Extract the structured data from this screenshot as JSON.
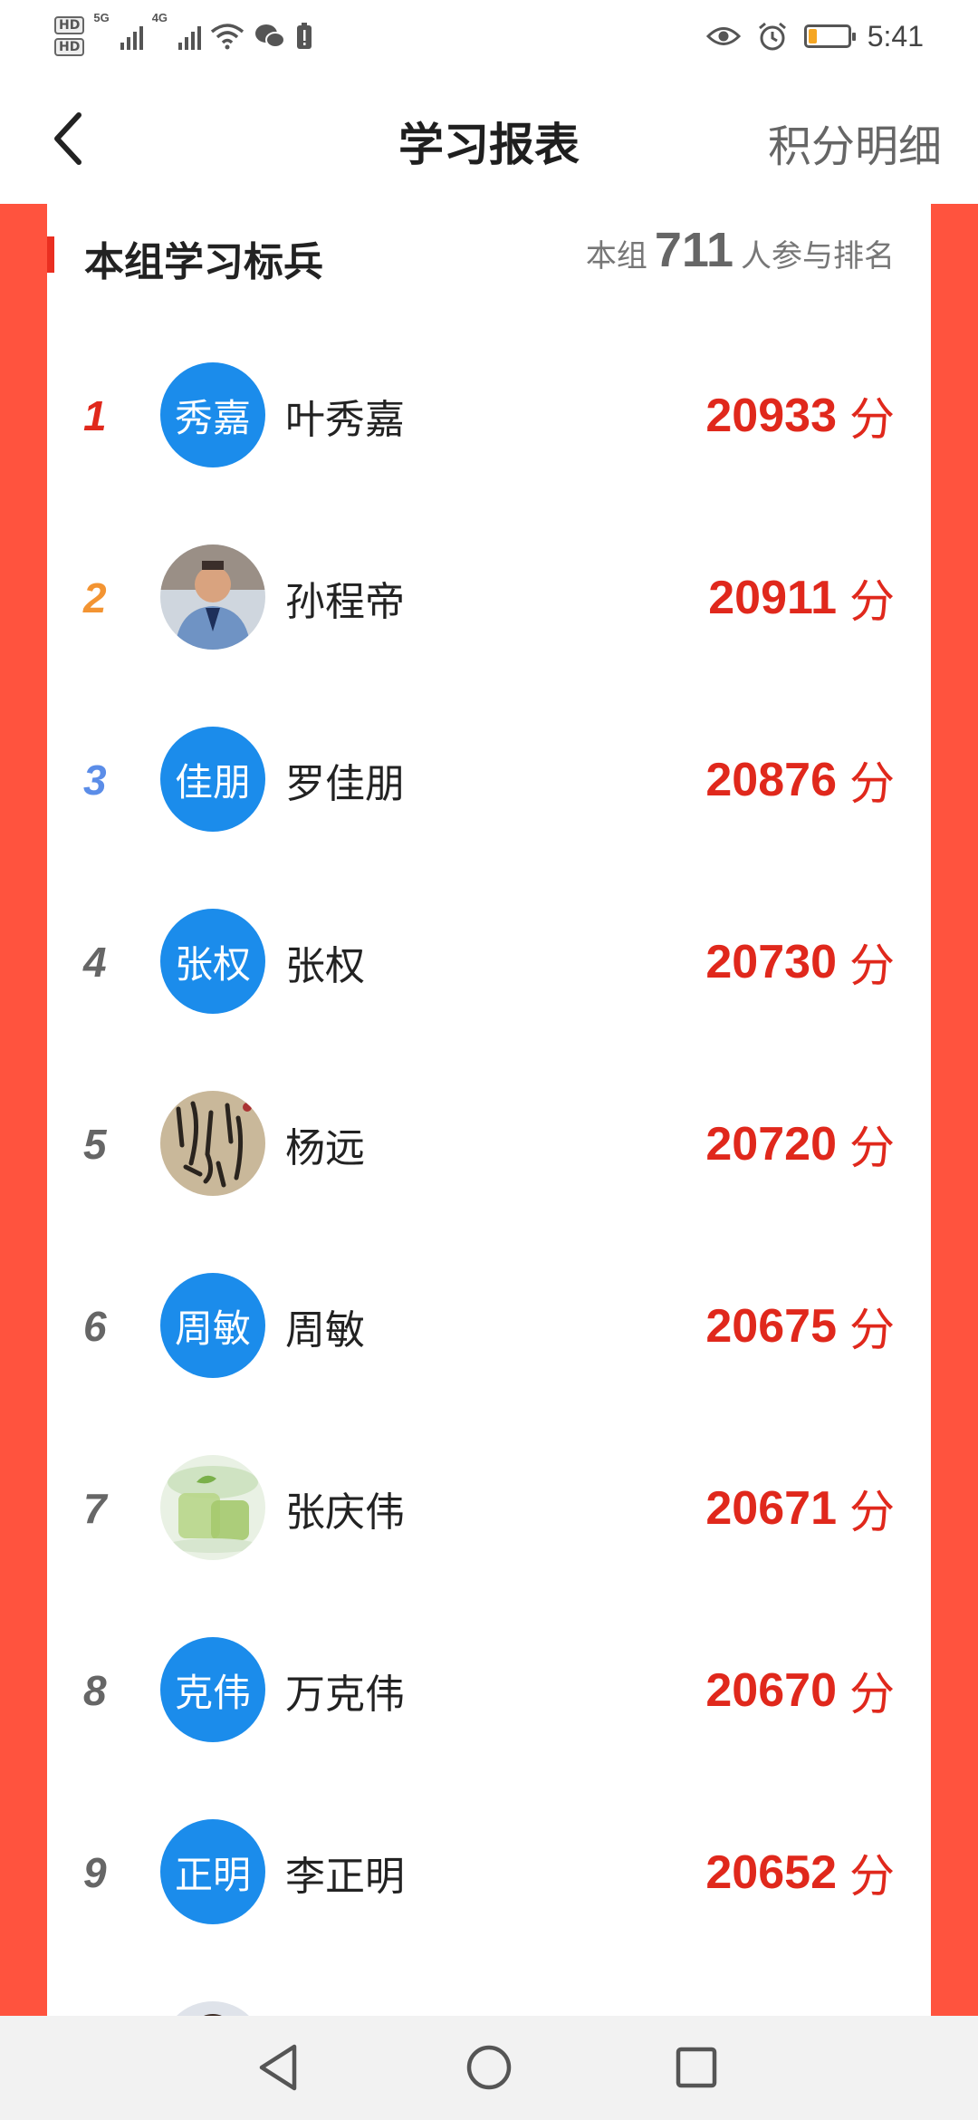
{
  "status_bar": {
    "hd1": "HD",
    "hd2": "HD",
    "net1": "5G",
    "net2": "4G",
    "time": "5:41",
    "battery_level": 0.2,
    "battery_color": "#f5a623"
  },
  "header": {
    "title": "学习报表",
    "detail_link": "积分明细"
  },
  "card": {
    "title": "本组学习标兵",
    "participants_prefix": "本组",
    "participants_count": "711",
    "participants_suffix": "人参与排名"
  },
  "colors": {
    "accent_red": "#e0281c",
    "frame_red": "#ff533e",
    "avatar_blue": "#1b8ceb",
    "rank1": "#e0281c",
    "rank2": "#f39432",
    "rank3": "#5b8de8",
    "rank_default": "#666666"
  },
  "ranking": [
    {
      "rank": "1",
      "avatar_text": "秀嘉",
      "avatar_type": "text",
      "name": "叶秀嘉",
      "score": "20933",
      "unit": "分"
    },
    {
      "rank": "2",
      "avatar_text": "",
      "avatar_type": "photo-officer",
      "name": "孙程帝",
      "score": "20911",
      "unit": "分"
    },
    {
      "rank": "3",
      "avatar_text": "佳朋",
      "avatar_type": "text",
      "name": "罗佳朋",
      "score": "20876",
      "unit": "分"
    },
    {
      "rank": "4",
      "avatar_text": "张权",
      "avatar_type": "text",
      "name": "张权",
      "score": "20730",
      "unit": "分"
    },
    {
      "rank": "5",
      "avatar_text": "",
      "avatar_type": "photo-calligraphy",
      "name": "杨远",
      "score": "20720",
      "unit": "分"
    },
    {
      "rank": "6",
      "avatar_text": "周敏",
      "avatar_type": "text",
      "name": "周敏",
      "score": "20675",
      "unit": "分"
    },
    {
      "rank": "7",
      "avatar_text": "",
      "avatar_type": "photo-tea",
      "name": "张庆伟",
      "score": "20671",
      "unit": "分"
    },
    {
      "rank": "8",
      "avatar_text": "克伟",
      "avatar_type": "text",
      "name": "万克伟",
      "score": "20670",
      "unit": "分"
    },
    {
      "rank": "9",
      "avatar_text": "正明",
      "avatar_type": "text",
      "name": "李正明",
      "score": "20652",
      "unit": "分"
    },
    {
      "rank": "",
      "avatar_text": "",
      "avatar_type": "photo-child",
      "name": "",
      "score": "",
      "unit": ""
    }
  ]
}
